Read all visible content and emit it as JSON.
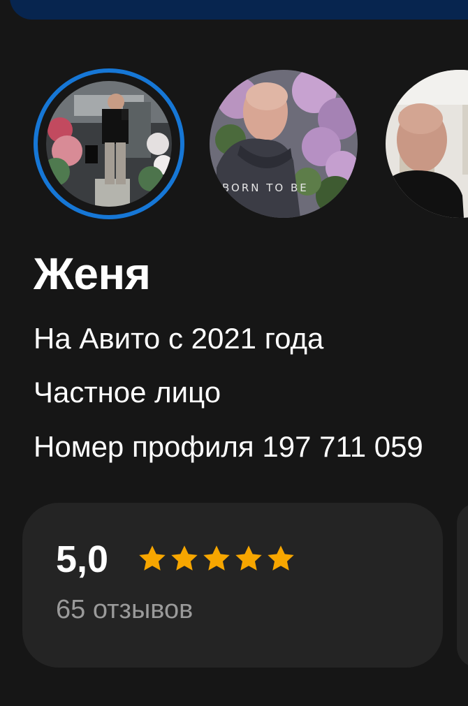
{
  "profile": {
    "name": "Женя",
    "member_since": "На Авито с 2021 года",
    "seller_type": "Частное лицо",
    "profile_number": "Номер профиля 197 711 059"
  },
  "avatars": [
    {
      "name": "avatar-story-1",
      "active": true
    },
    {
      "name": "avatar-story-2",
      "active": false,
      "caption": "BORN TO BE"
    },
    {
      "name": "avatar-story-3",
      "active": false
    }
  ],
  "rating": {
    "value": "5,0",
    "stars": 5,
    "reviews": "65 отзывов"
  },
  "colors": {
    "background": "#161616",
    "card": "#242424",
    "ring": "#1677d6",
    "star": "#f7a600",
    "banner": "#07254f",
    "muted_text": "#9a9a9a"
  }
}
